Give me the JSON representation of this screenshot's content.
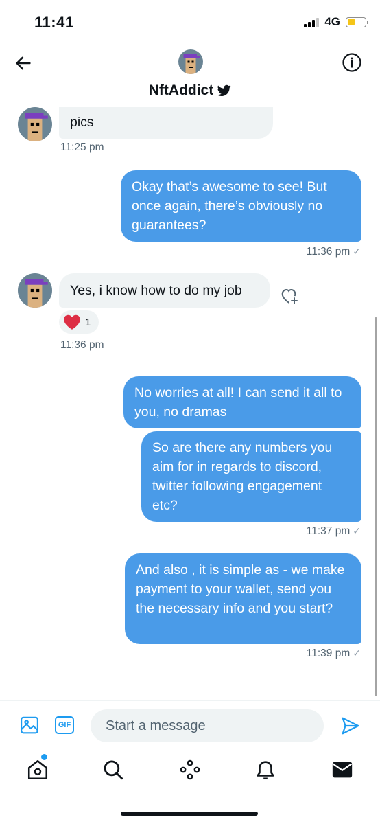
{
  "status_bar": {
    "time": "11:41",
    "network": "4G"
  },
  "header": {
    "title": "NftAddict",
    "verified_icon": "twitter-bird-icon"
  },
  "conversation": {
    "messages": [
      {
        "id": "m1",
        "direction": "incoming",
        "text": "pics",
        "timestamp": "11:25 pm"
      },
      {
        "id": "m2",
        "direction": "outgoing",
        "text": "Okay that’s awesome to see! But once again, there’s obviously no guarantees?",
        "timestamp": "11:36 pm"
      },
      {
        "id": "m3",
        "direction": "incoming",
        "text": "Yes, i know how to do my job",
        "timestamp": "11:36 pm",
        "reaction": {
          "icon": "heart-emoji",
          "count": "1"
        }
      },
      {
        "id": "m4",
        "direction": "outgoing",
        "text": "No worries at all! I can send it all to you, no dramas"
      },
      {
        "id": "m5",
        "direction": "outgoing",
        "text": "So are there any numbers you aim for in regards to discord, twitter following engagement etc?",
        "timestamp": "11:37 pm"
      },
      {
        "id": "m6",
        "direction": "outgoing",
        "text": "And also , it is simple as - we make payment to your wallet, send you the necessary info and you start?",
        "timestamp": "11:39 pm"
      }
    ],
    "seen_mark": "✓"
  },
  "compose": {
    "placeholder": "Start a message",
    "gif_label": "GIF"
  },
  "bottom_nav": {
    "items": [
      "home-icon",
      "search-icon",
      "spaces-icon",
      "notifications-icon",
      "messages-icon"
    ]
  },
  "colors": {
    "outgoing_bubble": "#4a9be8",
    "incoming_bubble": "#eff3f4",
    "accent": "#1d9bf0"
  }
}
